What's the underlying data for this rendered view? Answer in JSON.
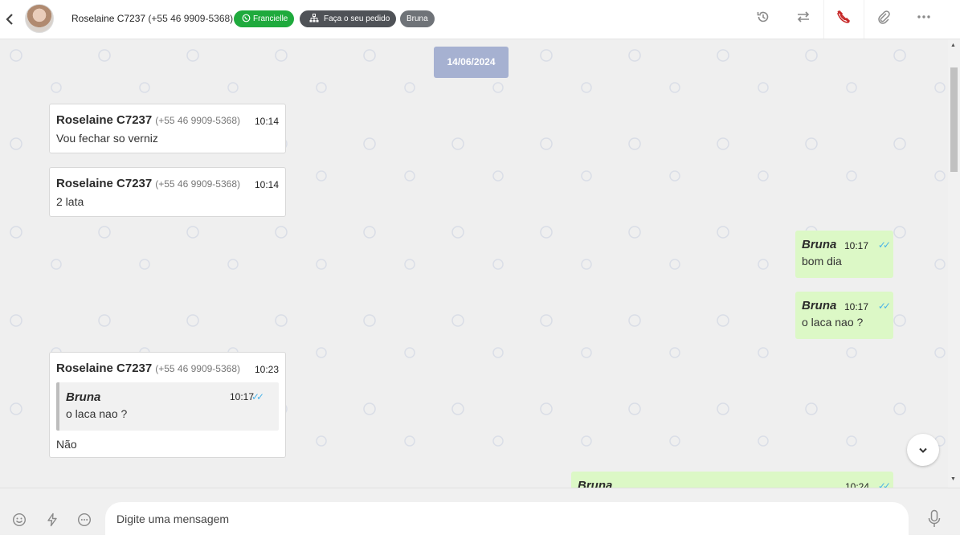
{
  "header": {
    "contact_name": "Roselaine C7237",
    "contact_phone": "(+55 46 9909-5368)",
    "tags": [
      {
        "label": "Francielle",
        "color": "#1faa3d",
        "icon": "whatsapp-icon"
      },
      {
        "label": "Faça o seu pedido",
        "color": "#4f5257",
        "icon": "sitemap-icon"
      },
      {
        "label": "Bruna",
        "color": "#6f7378"
      }
    ],
    "actions": [
      "history-icon",
      "transfer-icon",
      "end-call-icon",
      "attach-icon",
      "more-icon"
    ]
  },
  "chat": {
    "date": "14/06/2024",
    "messages": [
      {
        "direction": "in",
        "sender": "Roselaine C7237",
        "phone": "(+55 46 9909-5368)",
        "time": "10:14",
        "text": "Vou fechar so verniz"
      },
      {
        "direction": "in",
        "sender": "Roselaine C7237",
        "phone": "(+55 46 9909-5368)",
        "time": "10:14",
        "text": "2 lata"
      },
      {
        "direction": "out",
        "sender": "Bruna",
        "time": "10:17",
        "text": "bom dia",
        "status": "read"
      },
      {
        "direction": "out",
        "sender": "Bruna",
        "time": "10:17",
        "text": "o laca nao ?",
        "status": "read"
      },
      {
        "direction": "in",
        "sender": "Roselaine C7237",
        "phone": "(+55 46 9909-5368)",
        "time": "10:23",
        "text": "Não",
        "quote": {
          "sender": "Bruna",
          "time": "10:17",
          "text": "o laca nao ?"
        }
      },
      {
        "direction": "out",
        "sender": "Bruna",
        "time": "10:24",
        "text": "",
        "status": "read"
      }
    ]
  },
  "composer": {
    "placeholder": "Digite uma mensagem",
    "icons": [
      "emoji-icon",
      "quick-reply-icon",
      "chat-options-icon",
      "microphone-icon"
    ]
  },
  "colors": {
    "accent_green": "#1faa3d",
    "outgoing_bubble": "#dcf8c6",
    "read_check": "#4ab3e8",
    "date_chip": "#a6b1d1",
    "end_call": "#c62828"
  }
}
